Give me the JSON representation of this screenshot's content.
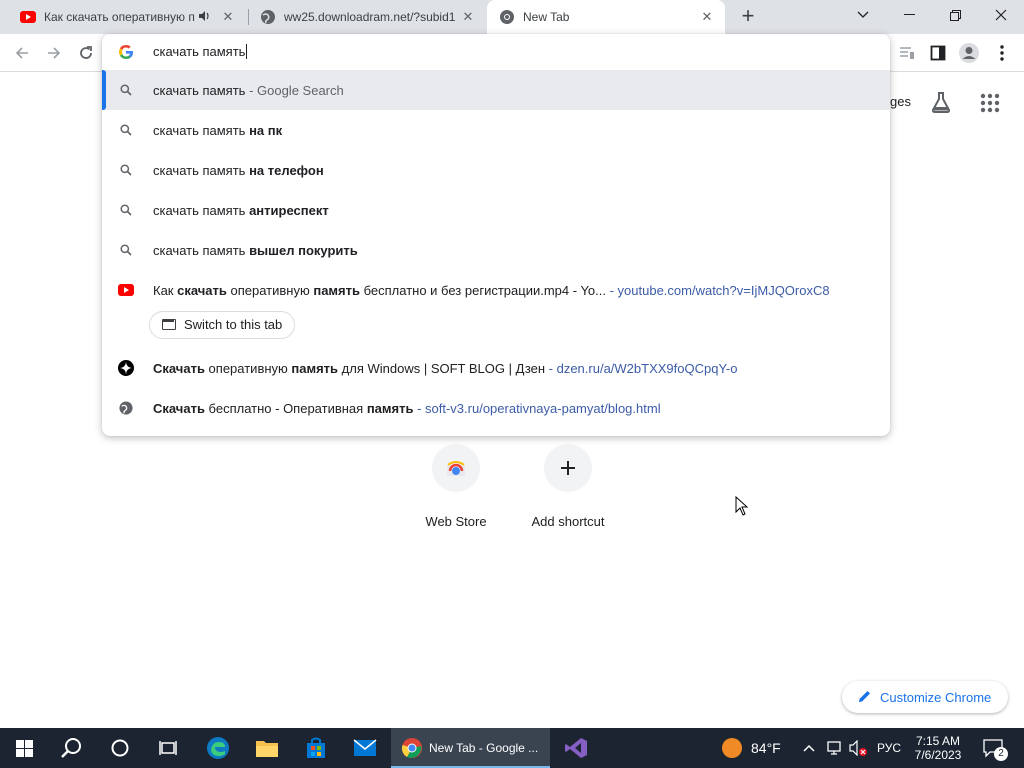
{
  "tabs": [
    {
      "title": "Как скачать оперативную п",
      "icon": "youtube-icon",
      "audio": true
    },
    {
      "title": "ww25.downloadram.net/?subid1",
      "icon": "globe-icon"
    },
    {
      "title": "New Tab",
      "icon": "chrome-icon",
      "active": true
    }
  ],
  "omnibox": {
    "typed": "скачать память",
    "suggestions": [
      {
        "icon": "search-icon",
        "text": "скачать память",
        "suffix": " - Google Search",
        "bold": "",
        "selected": true
      },
      {
        "icon": "search-icon",
        "text": "скачать память ",
        "bold": "на пк"
      },
      {
        "icon": "search-icon",
        "text": "скачать память ",
        "bold": "на телефон"
      },
      {
        "icon": "search-icon",
        "text": "скачать память ",
        "bold": "антиреспект"
      },
      {
        "icon": "search-icon",
        "text": "скачать память ",
        "bold": "вышел покурить"
      }
    ],
    "results": [
      {
        "icon": "youtube-icon",
        "parts": [
          "Как ",
          "скачать",
          " оперативную ",
          "память",
          " бесплатно и без регистрации.mp4 - Yo..."
        ],
        "url": " - youtube.com/watch?v=IjMJQOroxC8",
        "switch_label": "Switch to this tab"
      },
      {
        "icon": "dzen-icon",
        "parts": [
          "Скачать",
          " оперативную ",
          "память",
          " для Windows | SOFT BLOG | Дзен"
        ],
        "url": " - dzen.ru/a/W2bTXX9foQCpqY-o"
      },
      {
        "icon": "globe-icon",
        "parts": [
          "Скачать",
          " бесплатно - Оперативная ",
          "память"
        ],
        "url": " - soft-v3.ru/operativnaya-pamyat/blog.html"
      }
    ]
  },
  "ntp": {
    "images_link": "ges",
    "shortcuts": [
      {
        "label": "Web Store",
        "icon": "webstore-icon"
      },
      {
        "label": "Add shortcut",
        "icon": "plus-icon"
      }
    ],
    "customize_label": "Customize Chrome"
  },
  "taskbar": {
    "chrome_label": "New Tab - Google ...",
    "weather": "84°F",
    "lang": "РУС",
    "time": "7:15 AM",
    "date": "7/6/2023",
    "notifications": "2"
  },
  "colors": {
    "accent": "#1a73e8",
    "url": "#3c5ca8",
    "youtube": "#ff0000",
    "taskbar": "#1b2430"
  }
}
